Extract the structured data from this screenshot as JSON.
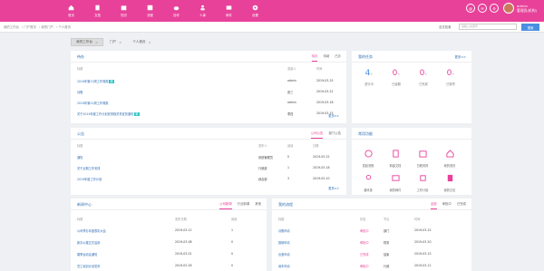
{
  "colors": {
    "brand": "#e8419a",
    "link": "#2e6db4",
    "tag": "#2ac3c3",
    "button": "#4a90e2"
  },
  "nav": [
    {
      "label": "首页",
      "icon": "home-icon"
    },
    {
      "label": "文档",
      "icon": "document-icon"
    },
    {
      "label": "知识",
      "icon": "book-icon"
    },
    {
      "label": "流程",
      "icon": "workflow-icon"
    },
    {
      "label": "协作",
      "icon": "cloud-icon"
    },
    {
      "label": "人事",
      "icon": "people-icon"
    },
    {
      "label": "邮件",
      "icon": "mail-icon"
    },
    {
      "label": "设置",
      "icon": "gear-icon"
    }
  ],
  "topbar": {
    "round_buttons": [
      "@",
      "✉",
      "⚙"
    ],
    "user_name": "admin",
    "user_dept": "管理员(机构)"
  },
  "breadcrumb": [
    "我的工作台",
    "门户首页",
    "我的门户",
    "个人首页"
  ],
  "search": {
    "label": "全文检索",
    "placeholder": "请输入关键字",
    "button": "搜索"
  },
  "page_tabs": [
    {
      "label": "我的工作台",
      "active": true
    },
    {
      "label": "门户",
      "active": false
    },
    {
      "label": "个人首页",
      "active": false
    }
  ],
  "p1": {
    "title": "待办",
    "tabs": [
      "待办",
      "待阅",
      "已办"
    ],
    "headers": [
      "标题",
      "发起人",
      "时间"
    ],
    "rows": [
      {
        "title": "2019年第13周工作周报",
        "tag": "新",
        "from": "admin",
        "time": "2019-03-25"
      },
      {
        "title": "请假",
        "tag": "",
        "from": "张三",
        "time": "2019-03-22"
      },
      {
        "title": "2019年第12周工作周报",
        "tag": "",
        "from": "admin",
        "time": "2019-03-18"
      },
      {
        "title": "关于2019年度工作计划安排相关事宜的通知",
        "tag": "新",
        "from": "李四",
        "time": "2019-03-15"
      }
    ],
    "more": "更多>>"
  },
  "p2": {
    "title": "我的任务",
    "link": "更多>>",
    "stats": [
      {
        "value": "4",
        "unit": "个",
        "label": "进行中"
      },
      {
        "value": "0",
        "unit": "个",
        "label": "已逾期"
      },
      {
        "value": "0",
        "unit": "个",
        "label": "已完成"
      },
      {
        "value": "0",
        "unit": "个",
        "label": "已暂停"
      }
    ]
  },
  "p3": {
    "title": "公告",
    "tabs": [
      "公司公告",
      "部门公告"
    ],
    "headers": [
      "标题",
      "发布人",
      "阅读",
      "日期"
    ],
    "rows": [
      {
        "title": "通知",
        "from": "系统管理员",
        "read": "0",
        "time": "2019-03-22"
      },
      {
        "title": "关于近期工作安排",
        "from": "行政部",
        "read": "1",
        "time": "2019-03-18"
      },
      {
        "title": "2019年度工作计划",
        "from": "综合部",
        "read": "3",
        "time": "2019-03-10"
      }
    ],
    "more": "更多>>"
  },
  "p4": {
    "title": "常用功能",
    "tools": [
      {
        "label": "发起流程",
        "icon": "flow-icon"
      },
      {
        "label": "新建文档",
        "icon": "doc-icon"
      },
      {
        "label": "日程安排",
        "icon": "calendar-icon"
      },
      {
        "label": "我的首页",
        "icon": "house-icon"
      },
      {
        "label": "通讯录",
        "icon": "contacts-icon"
      },
      {
        "label": "我的邮件",
        "icon": "letter-icon"
      },
      {
        "label": "工作计划",
        "icon": "plan-icon"
      },
      {
        "label": "我的日志",
        "icon": "log-icon"
      }
    ]
  },
  "p5": {
    "title": "新闻中心",
    "tabs": [
      "公司新闻",
      "行业新闻",
      "其他"
    ],
    "headers": [
      "标题",
      "发布日期",
      "阅读"
    ],
    "rows": [
      {
        "title": "公司举办年度表彰大会",
        "time": "2019-03-12",
        "read": "1"
      },
      {
        "title": "新办公楼正式启用",
        "time": "2019-03-08",
        "read": "0"
      },
      {
        "title": "春季运动会通知",
        "time": "2019-03-01",
        "read": "0"
      },
      {
        "title": "员工培训计划发布",
        "time": "2019-02-26",
        "read": "0"
      }
    ]
  },
  "p6": {
    "title": "我的流程",
    "tabs": [
      "全部",
      "审批中",
      "已完成"
    ],
    "headers": [
      "标题",
      "状态",
      "节点",
      "时间"
    ],
    "rows": [
      {
        "title": "请假申请",
        "status": "审批中",
        "node": "部门",
        "time": "2019-03-22"
      },
      {
        "title": "报销申请",
        "status": "审批中",
        "node": "财务",
        "time": "2019-03-20"
      },
      {
        "title": "出差申请",
        "status": "已完成",
        "node": "结束",
        "time": "2019-03-15"
      },
      {
        "title": "用车申请",
        "status": "审批中",
        "node": "行政",
        "time": "2019-03-11"
      }
    ]
  }
}
